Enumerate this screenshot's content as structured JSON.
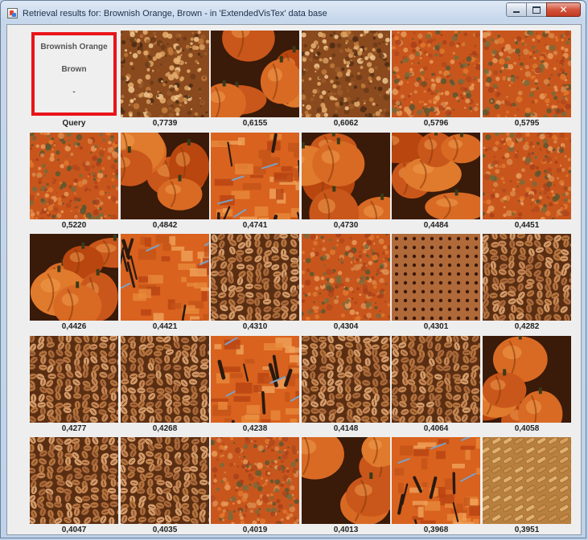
{
  "window": {
    "title": "Retrieval results for: Brownish Orange, Brown -  in 'ExtendedVisTex' data base",
    "close_glyph": "✕"
  },
  "query": {
    "labels": [
      "Brownish Orange",
      "Brown",
      "-"
    ],
    "caption": "Query",
    "border_color": "#e8141a"
  },
  "results": [
    {
      "score": "0,7739",
      "texture": "foliage-brown"
    },
    {
      "score": "0,6155",
      "texture": "pumpkins"
    },
    {
      "score": "0,6062",
      "texture": "foliage-brown"
    },
    {
      "score": "0,5796",
      "texture": "foliage-orange"
    },
    {
      "score": "0,5795",
      "texture": "foliage-orange"
    },
    {
      "score": "0,5220",
      "texture": "foliage-orange"
    },
    {
      "score": "0,4842",
      "texture": "pumpkins"
    },
    {
      "score": "0,4741",
      "texture": "painting"
    },
    {
      "score": "0,4730",
      "texture": "pumpkins"
    },
    {
      "score": "0,4484",
      "texture": "pumpkins"
    },
    {
      "score": "0,4451",
      "texture": "foliage-orange"
    },
    {
      "score": "0,4426",
      "texture": "pumpkins"
    },
    {
      "score": "0,4421",
      "texture": "painting"
    },
    {
      "score": "0,4310",
      "texture": "beans"
    },
    {
      "score": "0,4304",
      "texture": "foliage-orange"
    },
    {
      "score": "0,4301",
      "texture": "pegboard"
    },
    {
      "score": "0,4282",
      "texture": "beans"
    },
    {
      "score": "0,4277",
      "texture": "beans"
    },
    {
      "score": "0,4268",
      "texture": "beans"
    },
    {
      "score": "0,4238",
      "texture": "painting"
    },
    {
      "score": "0,4148",
      "texture": "beans"
    },
    {
      "score": "0,4064",
      "texture": "beans"
    },
    {
      "score": "0,4058",
      "texture": "pumpkins"
    },
    {
      "score": "0,4047",
      "texture": "beans"
    },
    {
      "score": "0,4035",
      "texture": "beans"
    },
    {
      "score": "0,4019",
      "texture": "foliage-orange"
    },
    {
      "score": "0,4013",
      "texture": "pumpkins"
    },
    {
      "score": "0,3968",
      "texture": "painting"
    },
    {
      "score": "0,3951",
      "texture": "weave"
    }
  ]
}
